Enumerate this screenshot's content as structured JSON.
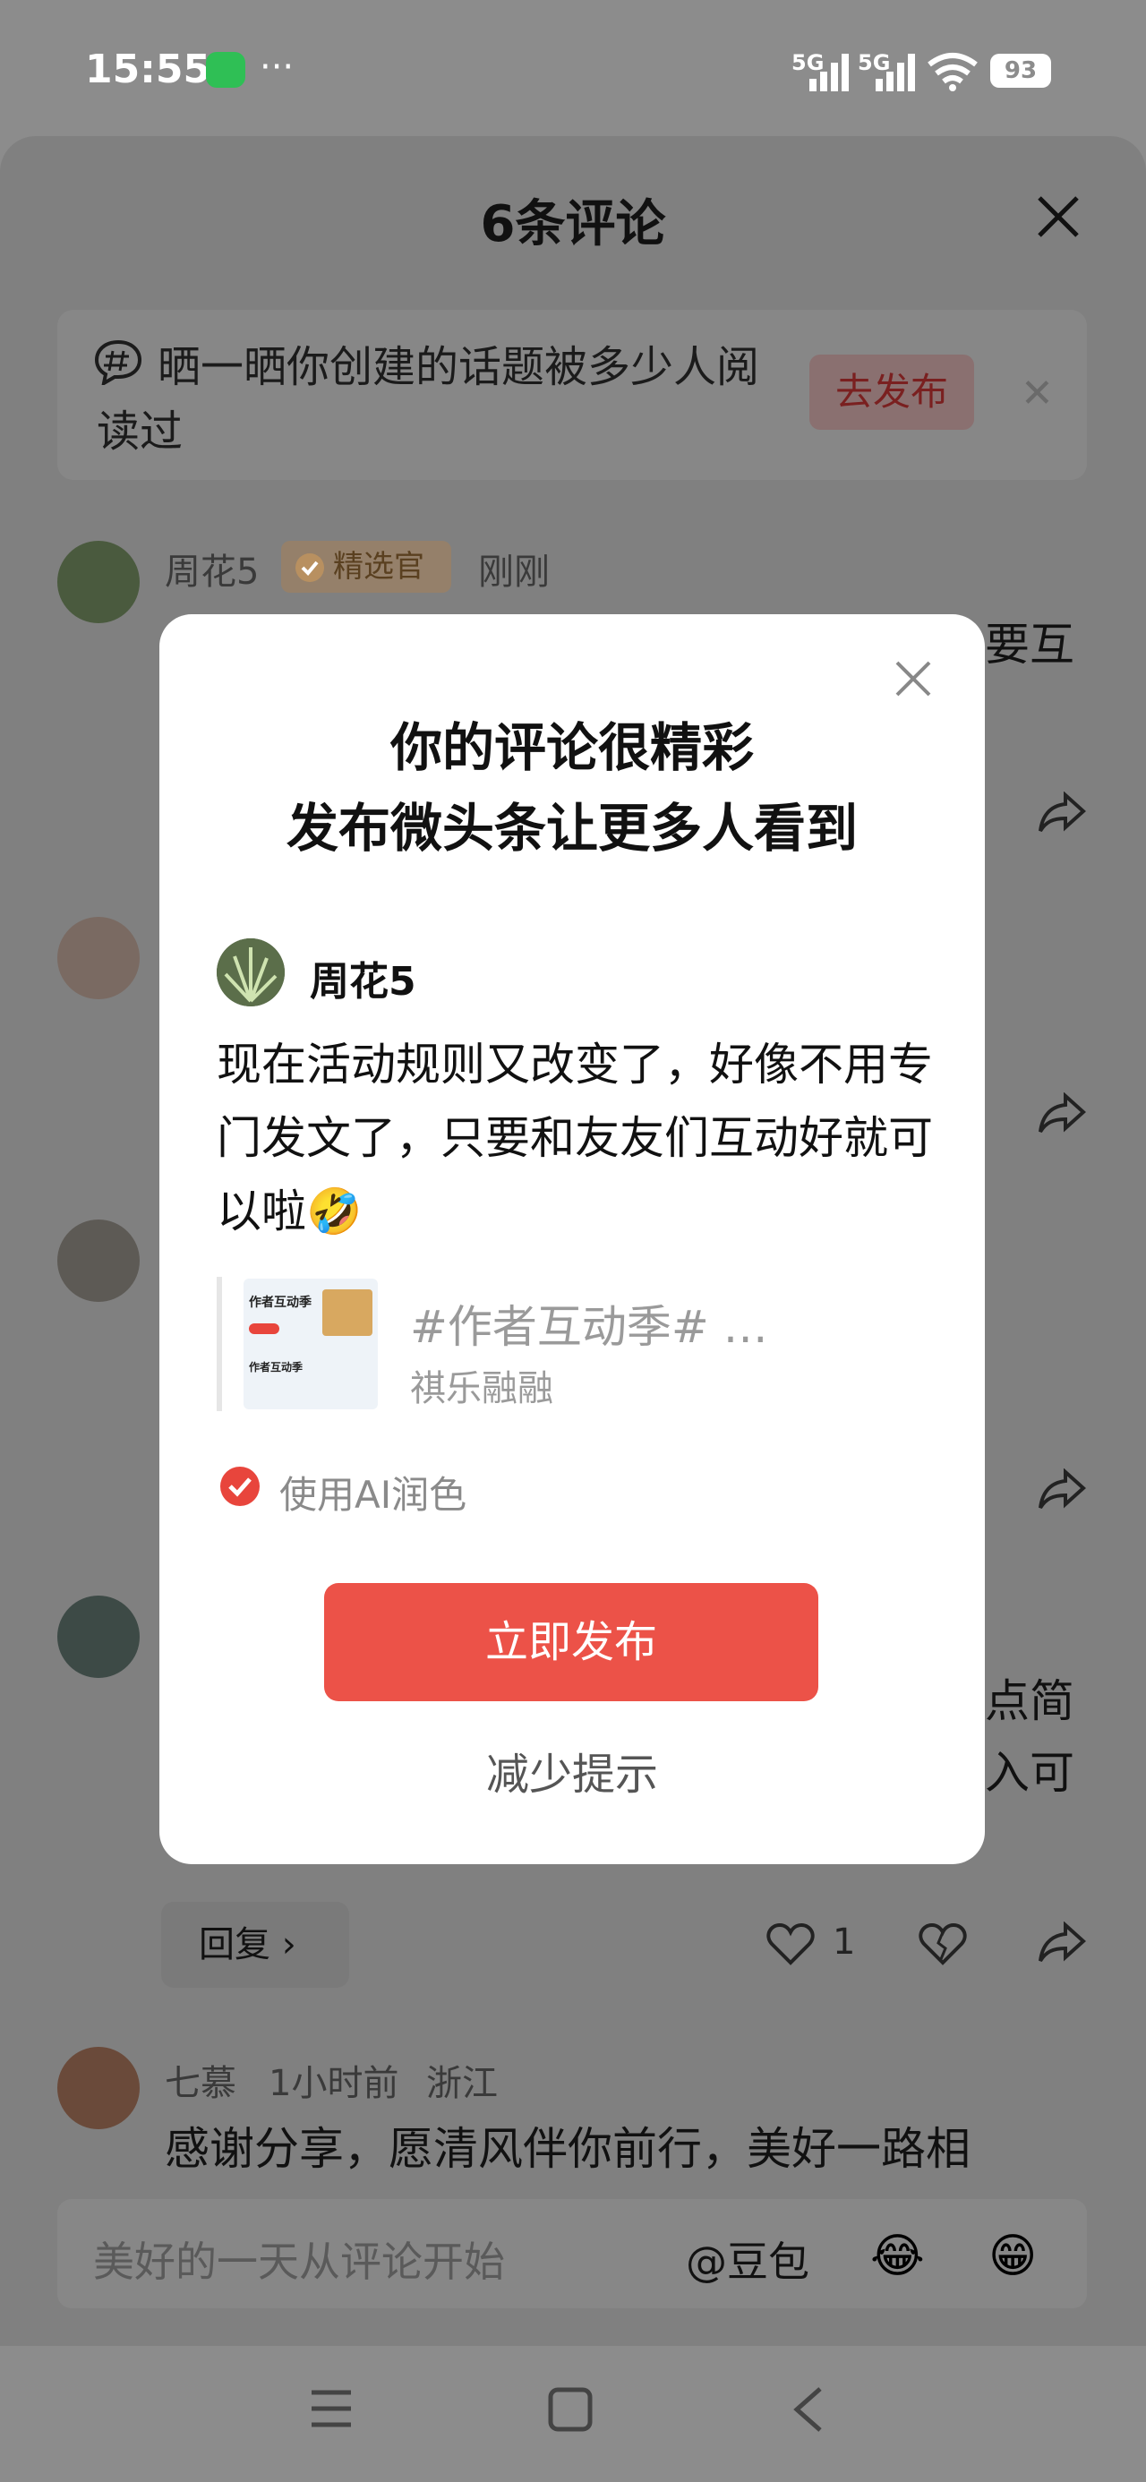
{
  "status_bar": {
    "time": "15:55",
    "more": "···",
    "signal1": "5G",
    "signal2": "5G",
    "battery": "93"
  },
  "comments_sheet": {
    "title": "6条评论",
    "banner": {
      "text": "晒一晒你创建的话题被多少人阅读过",
      "button": "去发布"
    },
    "comments": [
      {
        "name": "周花5",
        "badge": "精选官",
        "time": "刚刚",
        "text_tail": "要互"
      },
      {
        "name": "",
        "text": ""
      },
      {
        "name": "",
        "text": ""
      },
      {
        "name": "",
        "text_tail1": "点简",
        "text_tail2": "入可"
      },
      {
        "name": "七慕",
        "time": "1小时前",
        "location": "浙江",
        "text": "感谢分享，愿清风伴你前行，美好一路相"
      }
    ],
    "reply_label": "回复 ›",
    "like_count": "1",
    "comment_placeholder": "美好的一天从评论开始",
    "at_doubao": "@豆包",
    "emoji1": "😂",
    "emoji2": "😁"
  },
  "modal": {
    "title_line1": "你的评论很精彩",
    "title_line2": "发布微头条让更多人看到",
    "username": "周花5",
    "comment_text": "现在活动规则又改变了，好像不用专门发文了，只要和友友们互动好就可以啦",
    "emoji": "🤣",
    "topic_title": "#作者互动季# …",
    "topic_author": "祺乐融融",
    "thumb_line1": "作者互动季",
    "thumb_line2": "作者互动季",
    "ai_label": "使用AI润色",
    "publish_button": "立即发布",
    "reduce_hint": "减少提示"
  },
  "colors": {
    "accent_red": "#ec5248",
    "overlay": "#8c8c8c"
  }
}
